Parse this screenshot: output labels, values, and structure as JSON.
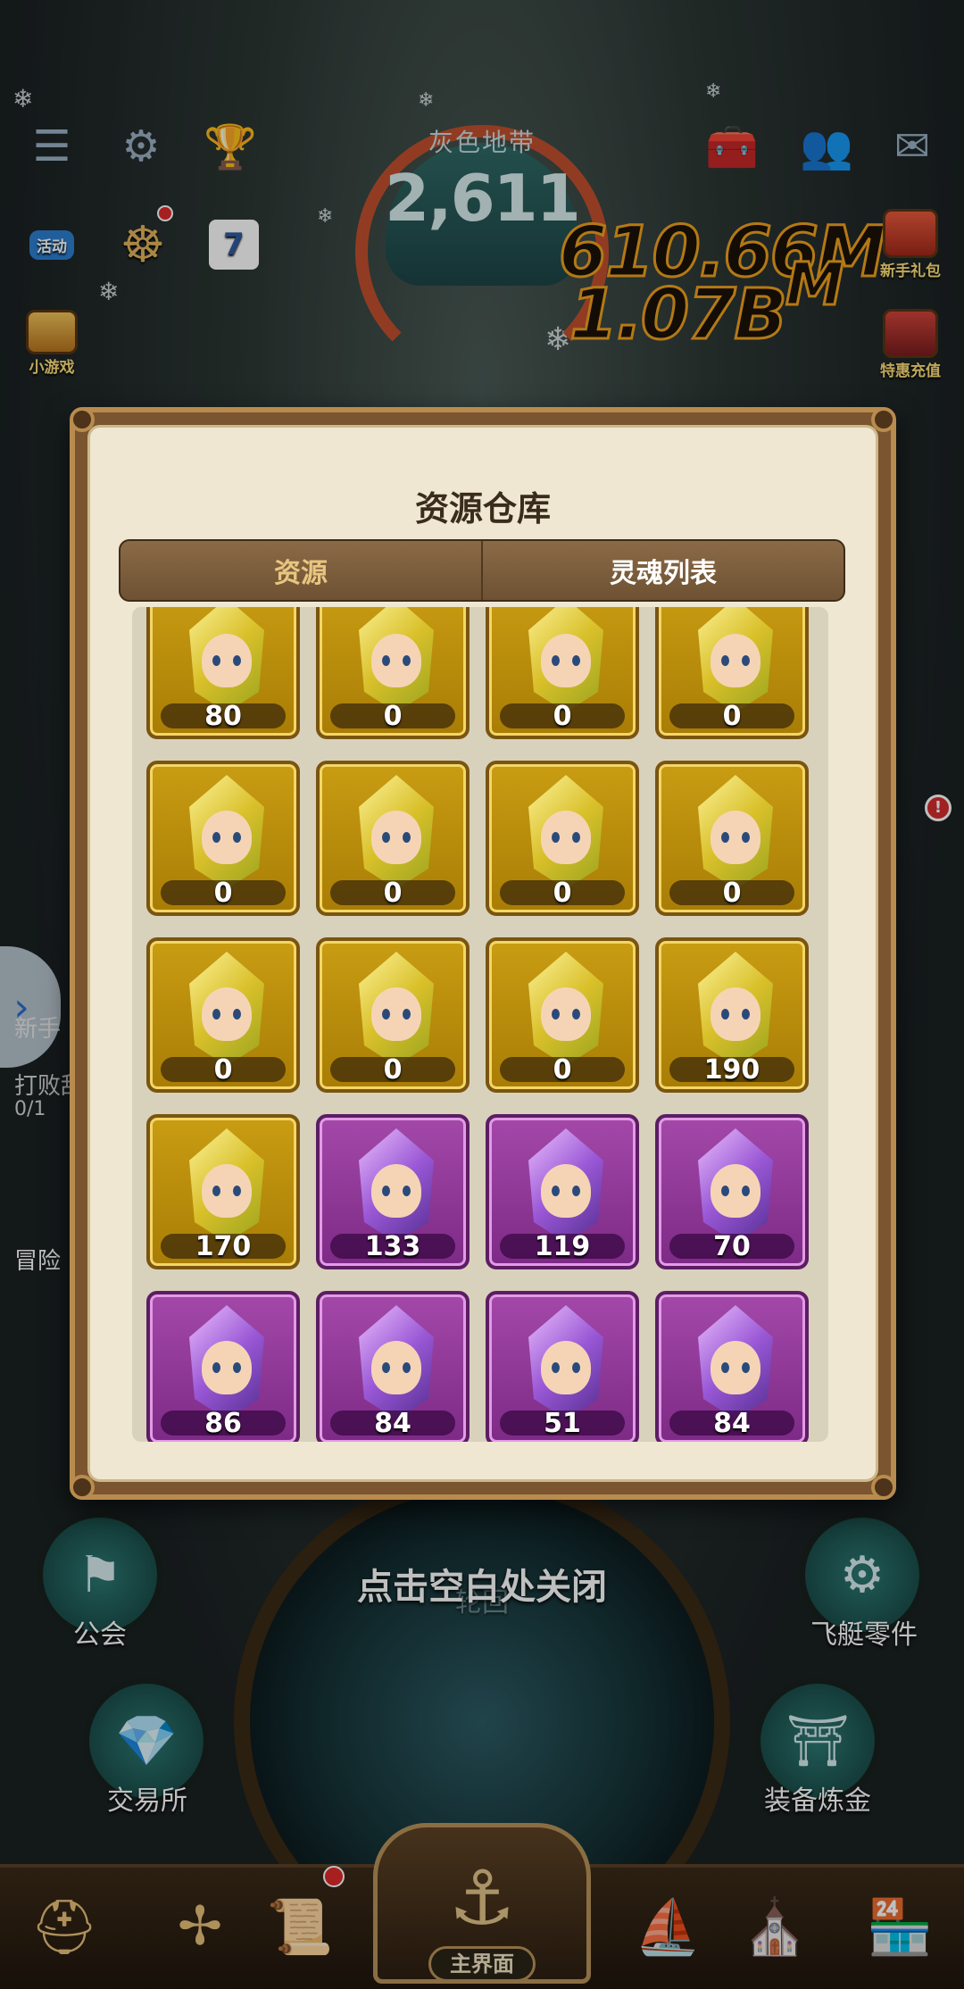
{
  "hud": {
    "zone_label": "灰色地带",
    "zone_value": "2,611",
    "stat_primary": "610.66M",
    "stat_secondary": "1.07B",
    "stat_secondary_suffix": "M"
  },
  "side_buttons": {
    "activity": "活动",
    "mini_game": "小游戏",
    "newbie_gift": "新手礼包",
    "special_offer": "特惠充值",
    "seven": "7"
  },
  "left_panel": {
    "newbie_label": "新手",
    "task_text": "打败敌",
    "task_progress": "0/1",
    "adventure": "冒险"
  },
  "modal": {
    "title": "资源仓库",
    "tabs": [
      {
        "label": "资源",
        "active": false
      },
      {
        "label": "灵魂列表",
        "active": true
      }
    ],
    "souls": [
      {
        "count": "80",
        "rarity": "gold"
      },
      {
        "count": "0",
        "rarity": "gold"
      },
      {
        "count": "0",
        "rarity": "gold"
      },
      {
        "count": "0",
        "rarity": "gold"
      },
      {
        "count": "0",
        "rarity": "gold"
      },
      {
        "count": "0",
        "rarity": "gold"
      },
      {
        "count": "0",
        "rarity": "gold"
      },
      {
        "count": "0",
        "rarity": "gold"
      },
      {
        "count": "0",
        "rarity": "gold"
      },
      {
        "count": "0",
        "rarity": "gold"
      },
      {
        "count": "0",
        "rarity": "gold"
      },
      {
        "count": "190",
        "rarity": "gold"
      },
      {
        "count": "170",
        "rarity": "gold"
      },
      {
        "count": "133",
        "rarity": "purple"
      },
      {
        "count": "119",
        "rarity": "purple"
      },
      {
        "count": "70",
        "rarity": "purple"
      },
      {
        "count": "86",
        "rarity": "purple"
      },
      {
        "count": "84",
        "rarity": "purple"
      },
      {
        "count": "51",
        "rarity": "purple"
      },
      {
        "count": "84",
        "rarity": "purple"
      }
    ]
  },
  "close_hint": "点击空白处关闭",
  "base": {
    "guild": "公会",
    "airship_parts": "飞艇零件",
    "exchange": "交易所",
    "equip_refine": "装备炼金",
    "portal_label": "轮回"
  },
  "bottom_nav": {
    "main_label": "主界面"
  },
  "colors": {
    "gold_rarity": "#c89c12",
    "purple_rarity": "#a348a9",
    "modal_bg": "#efe7d1",
    "tab_bar": "#7a5a3a"
  }
}
